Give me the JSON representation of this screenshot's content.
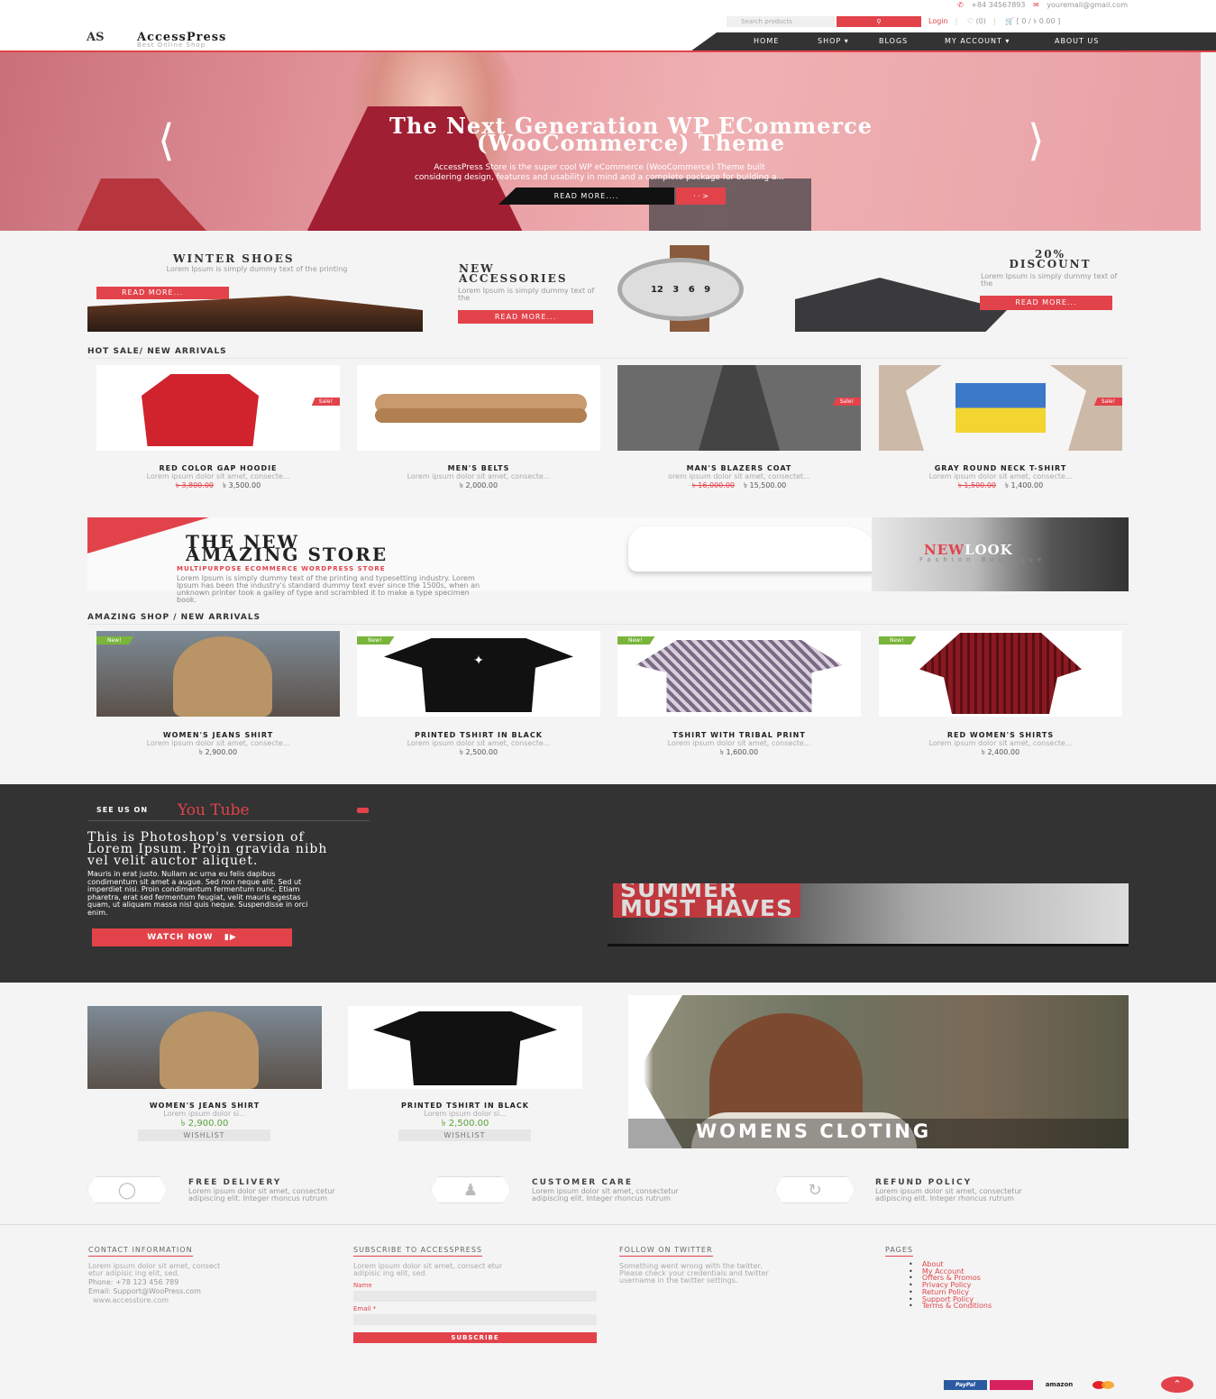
{
  "colors": {
    "accent": "#e2434b",
    "dark": "#333333",
    "new_badge": "#7ab53b"
  },
  "topbar": {
    "phone": "+84 34567893",
    "email": "youremail@gmail.com",
    "search_placeholder": "Search products",
    "login": "Login",
    "wishlist": "(0)",
    "cart": "[ 0 / ৳ 0.00 ]"
  },
  "logo": {
    "mark": "AS",
    "title": "AccessPress",
    "subtitle": "Best Online Shop"
  },
  "nav": [
    {
      "label": "HOME"
    },
    {
      "label": "SHOP"
    },
    {
      "label": "BLOGS"
    },
    {
      "label": "MY ACCOUNT"
    },
    {
      "label": "ABOUT US"
    }
  ],
  "hero": {
    "title_line1": "The Next Generation WP ECommerce",
    "title_line2": "(WooCommerce) Theme",
    "text_line1": "AccessPress Store is the super cool WP eCommerce (WooCommerce) Theme built",
    "text_line2": "considering design, features and usability in mind and a complete package for building a...",
    "button": "READ MORE....",
    "button2": "· · >"
  },
  "promos": [
    {
      "title": "WINTER SHOES",
      "text": "Lorem Ipsum is simply dummy text of the printing",
      "button": "READ MORE..."
    },
    {
      "title_line1": "NEW",
      "title_line2": "ACCESSORIES",
      "text": "Lorem Ipsum is simply dummy text of the",
      "button": "READ MORE..."
    },
    {
      "title_line1": "20%",
      "title_line2": "DISCOUNT",
      "text": "Lorem Ipsum is simply dummy text of the",
      "button": "READ MORE..."
    }
  ],
  "hot_sale": {
    "heading": "HOT SALE/ NEW ARRIVALS",
    "badge": "Sale!",
    "products": [
      {
        "name": "RED COLOR GAP HOODIE",
        "desc": "Lorem ipsum dolor sit amet, consecte...",
        "old_price": "৳ 3,800.00",
        "price": "৳ 3,500.00"
      },
      {
        "name": "MEN'S BELTS",
        "desc": "Lorem ipsum dolor sit amet, consecte...",
        "old_price": "",
        "price": "৳ 2,000.00"
      },
      {
        "name": "MAN'S BLAZERS COAT",
        "desc": "orem ipsum dolor sit amet, consectet...",
        "old_price": "৳ 16,000.00",
        "price": "৳ 15,500.00"
      },
      {
        "name": "GRAY ROUND NECK T-SHIRT",
        "desc": "Lorem ipsum dolor sit amet, consecte...",
        "old_price": "৳ 1,500.00",
        "price": "৳ 1,400.00"
      }
    ]
  },
  "banner": {
    "title_line1": "THE NEW",
    "title_line2": "AMAZING STORE",
    "subtitle": "MULTIPURPOSE ECOMMERCE WORDPRESS STORE",
    "text_line1": "Lorem Ipsum is simply dummy text of the printing and typesetting industry. Lorem",
    "text_line2": "Ipsum has been the industry's standard dummy text ever since the 1500s, when an",
    "text_line3": "unknown printer took a galley of type and scrambled it to make a type specimen",
    "text_line4": "book.",
    "newlook_new": "NEW",
    "newlook_look": "LOOK",
    "newlook_sub": "Fashion Boutique"
  },
  "amazing": {
    "heading": "AMAZING SHOP / NEW ARRIVALS",
    "badge": "New!",
    "products": [
      {
        "name": "WOMEN'S JEANS SHIRT",
        "desc": "Lorem ipsum dolor sit amet, consecte...",
        "price": "৳ 2,900.00"
      },
      {
        "name": "PRINTED TSHIRT IN BLACK",
        "desc": "Lorem ipsum dolor sit amet, consecte...",
        "price": "৳ 2,500.00"
      },
      {
        "name": "TSHIRT WITH TRIBAL PRINT",
        "desc": "Lorem ipsum dolor sit amet, consecte...",
        "price": "৳ 1,600.00"
      },
      {
        "name": "RED WOMEN'S SHIRTS",
        "desc": "Lorem ipsum dolor sit amet, consecte...",
        "price": "৳ 2,400.00"
      }
    ]
  },
  "video": {
    "see_us": "SEE US ON",
    "youtube": "You Tube",
    "title_line1": "This is Photoshop's version of",
    "title_line2": "Lorem Ipsum. Proin gravida nibh",
    "title_line3": "vel velit auctor aliquet.",
    "text_line1": "Mauris in erat justo. Nullam ac urna eu felis dapibus",
    "text_line2": "condimentum sit amet a augue. Sed non neque elit. Sed ut",
    "text_line3": "imperdiet nisi. Proin condimentum fermentum nunc. Etiam",
    "text_line4": "pharetra, erat sed fermentum feugiat, velit mauris egestas",
    "text_line5": "quam, ut aliquam massa nisl quis neque. Suspendisse in orci",
    "text_line6": "enim.",
    "button": "WATCH NOW",
    "image_text_top": "SUMMER",
    "image_text": "MUST HAVES"
  },
  "wishlist_products": [
    {
      "name": "WOMEN'S JEANS SHIRT",
      "desc": "Lorem ipsum dolor si...",
      "price": "৳ 2,900.00",
      "button": "WISHLIST"
    },
    {
      "name": "PRINTED TSHIRT IN BLACK",
      "desc": "Lorem ipsum dolor si...",
      "price": "৳ 2,500.00",
      "button": "WISHLIST"
    }
  ],
  "womens_cloting": "WOMENS CLOTING",
  "features": [
    {
      "title": "FREE DELIVERY",
      "text_line1": "Lorem ipsum dolor sit amet, consectetur",
      "text_line2": "adipiscing elit. Integer rhoncus rutrum"
    },
    {
      "title": "CUSTOMER CARE",
      "text_line1": "Lorem ipsum dolor sit amet, consectetur",
      "text_line2": "adipiscing elit. Integer rhoncus rutrum"
    },
    {
      "title": "REFUND POLICY",
      "text_line1": "Lorem ipsum dolor sit amet, consectetur",
      "text_line2": "adipiscing elit. Integer rhoncus rutrum"
    }
  ],
  "footer": {
    "contact": {
      "heading": "CONTACT INFORMATION",
      "text_line1": "Lorem ipsum dolor sit amet, consect",
      "text_line2": "etur adipisic ing elit, sed.",
      "phone": "Phone: +78 123 456 789",
      "email": "Email: Support@WooPress.com",
      "website": "www.accesstore.com"
    },
    "subscribe": {
      "heading": "SUBSCRIBE TO ACCESSPRESS",
      "text_line1": "Lorem ipsum dolor sit amet, consect etur",
      "text_line2": "adipisic ing elit, sed.",
      "name_label": "Name",
      "email_label": "Email *",
      "button": "SUBSCRIBE"
    },
    "twitter": {
      "heading": "FOLLOW ON TWITTER",
      "text_line1": "Something went wrong with the twitter.",
      "text_line2": "Please check your credentials and twitter",
      "text_line3": "username in the twitter settings."
    },
    "pages": {
      "heading": "PAGES",
      "items": [
        "About",
        "My Account",
        "Offers & Promos",
        "Privacy Policy",
        "Return Policy",
        "Support Policy",
        "Terms & Conditions"
      ]
    }
  },
  "payments": [
    "PayPal",
    "amazon"
  ]
}
